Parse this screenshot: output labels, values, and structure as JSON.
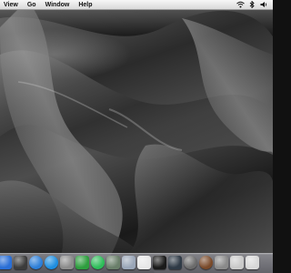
{
  "menubar": {
    "items": [
      "View",
      "Go",
      "Window",
      "Help"
    ],
    "status_icons": [
      "wifi-icon",
      "bluetooth-icon",
      "volume-icon"
    ]
  },
  "dock": {
    "icons": [
      {
        "name": "finder-icon",
        "color": "#2a6fd6"
      },
      {
        "name": "dashboard-icon",
        "color": "#3b3b3b"
      },
      {
        "name": "safari-icon",
        "color": "#2d7fd8"
      },
      {
        "name": "itunes-icon",
        "color": "#1e8ee0"
      },
      {
        "name": "iphoto-icon",
        "color": "#8c8c8c"
      },
      {
        "name": "app-icon-green",
        "color": "#2e9e3e"
      },
      {
        "name": "spotify-icon",
        "color": "#2ebd59"
      },
      {
        "name": "chat-icon",
        "color": "#6a7f6a"
      },
      {
        "name": "preview-icon",
        "color": "#9aa6b8"
      },
      {
        "name": "ical-icon",
        "color": "#e8e8e8"
      },
      {
        "name": "terminal-icon",
        "color": "#1a1a1a"
      },
      {
        "name": "activity-monitor-icon",
        "color": "#2f3a46"
      },
      {
        "name": "globe-icon",
        "color": "#6b6b6b"
      },
      {
        "name": "chess-icon",
        "color": "#7a4a2a"
      },
      {
        "name": "system-preferences-icon",
        "color": "#8a8a8a"
      },
      {
        "name": "calculator-icon",
        "color": "#c9c9c9"
      },
      {
        "name": "trash-icon",
        "color": "#d8d8d8"
      }
    ]
  }
}
